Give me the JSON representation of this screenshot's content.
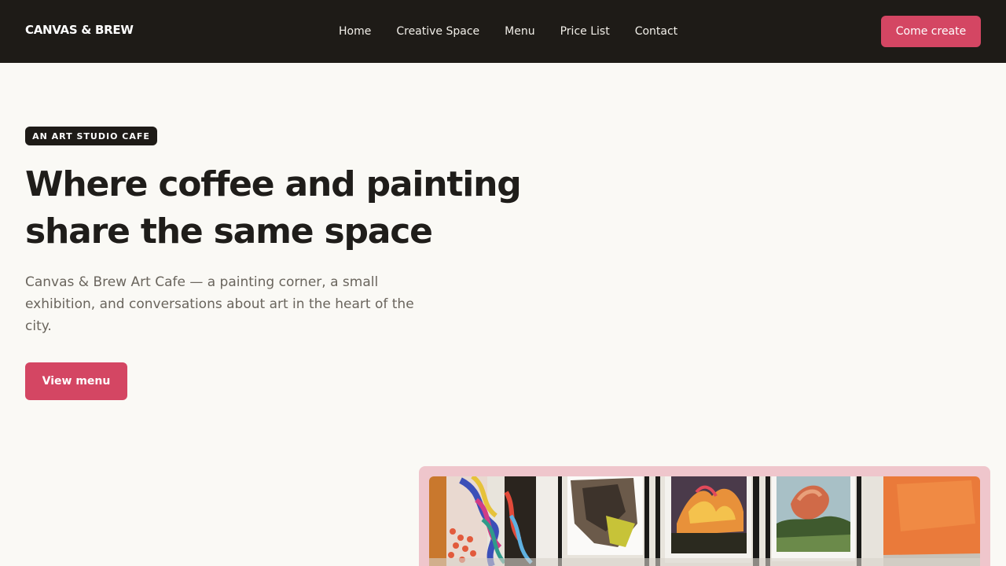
{
  "header": {
    "brand": "CANVAS & BREW",
    "nav": [
      {
        "label": "Home"
      },
      {
        "label": "Creative Space"
      },
      {
        "label": "Menu"
      },
      {
        "label": "Price List"
      },
      {
        "label": "Contact"
      }
    ],
    "cta_label": "Come create"
  },
  "hero": {
    "badge": "AN ART STUDIO CAFE",
    "title": "Where coffee and painting share the same space",
    "subtitle": "Canvas & Brew Art Cafe — a painting corner, a small exhibition, and conversations about art in the heart of the city.",
    "cta_label": "View menu"
  },
  "colors": {
    "accent": "#d44663",
    "dark": "#1e1b17",
    "background": "#faf9f5",
    "frame": "#efc6cc"
  }
}
